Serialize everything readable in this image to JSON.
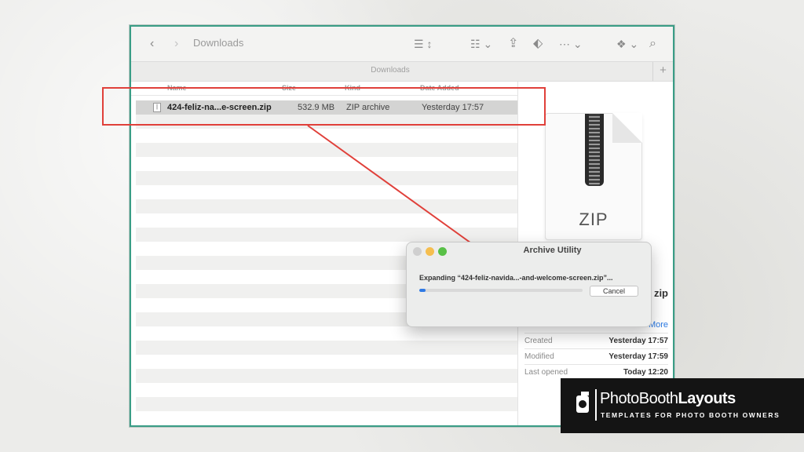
{
  "finder": {
    "title": "Downloads",
    "tab_label": "Downloads",
    "tab_plus": "+",
    "toolbar_icons": [
      "back-icon",
      "forward-icon",
      "list-view-icon",
      "grid-view-icon",
      "share-icon",
      "tag-icon",
      "more-icon",
      "dropbox-icon",
      "search-icon"
    ],
    "columns": {
      "name": "Name",
      "size": "Size",
      "kind": "Kind",
      "date": "Date Added"
    },
    "file": {
      "name": "424-feliz-na...e-screen.zip",
      "size": "532.9 MB",
      "kind": "ZIP archive",
      "date": "Yesterday 17:57"
    },
    "preview": {
      "icon_text": "ZIP",
      "name_fragment": "zip",
      "more_link": "More",
      "meta": [
        {
          "label": "Created",
          "value": "Yesterday 17:57"
        },
        {
          "label": "Modified",
          "value": "Yesterday 17:59"
        },
        {
          "label": "Last opened",
          "value": "Today 12:20"
        }
      ]
    }
  },
  "dialog": {
    "title": "Archive Utility",
    "message": "Expanding “424-feliz-navida...-and-welcome-screen.zip”...",
    "progress": 0.04,
    "cancel_label": "Cancel"
  },
  "annotation": {
    "color": "#e0403a"
  },
  "brand": {
    "name_light": "PhotoBooth",
    "name_bold": "Layouts",
    "tagline": "TEMPLATES FOR PHOTO BOOTH OWNERS"
  }
}
